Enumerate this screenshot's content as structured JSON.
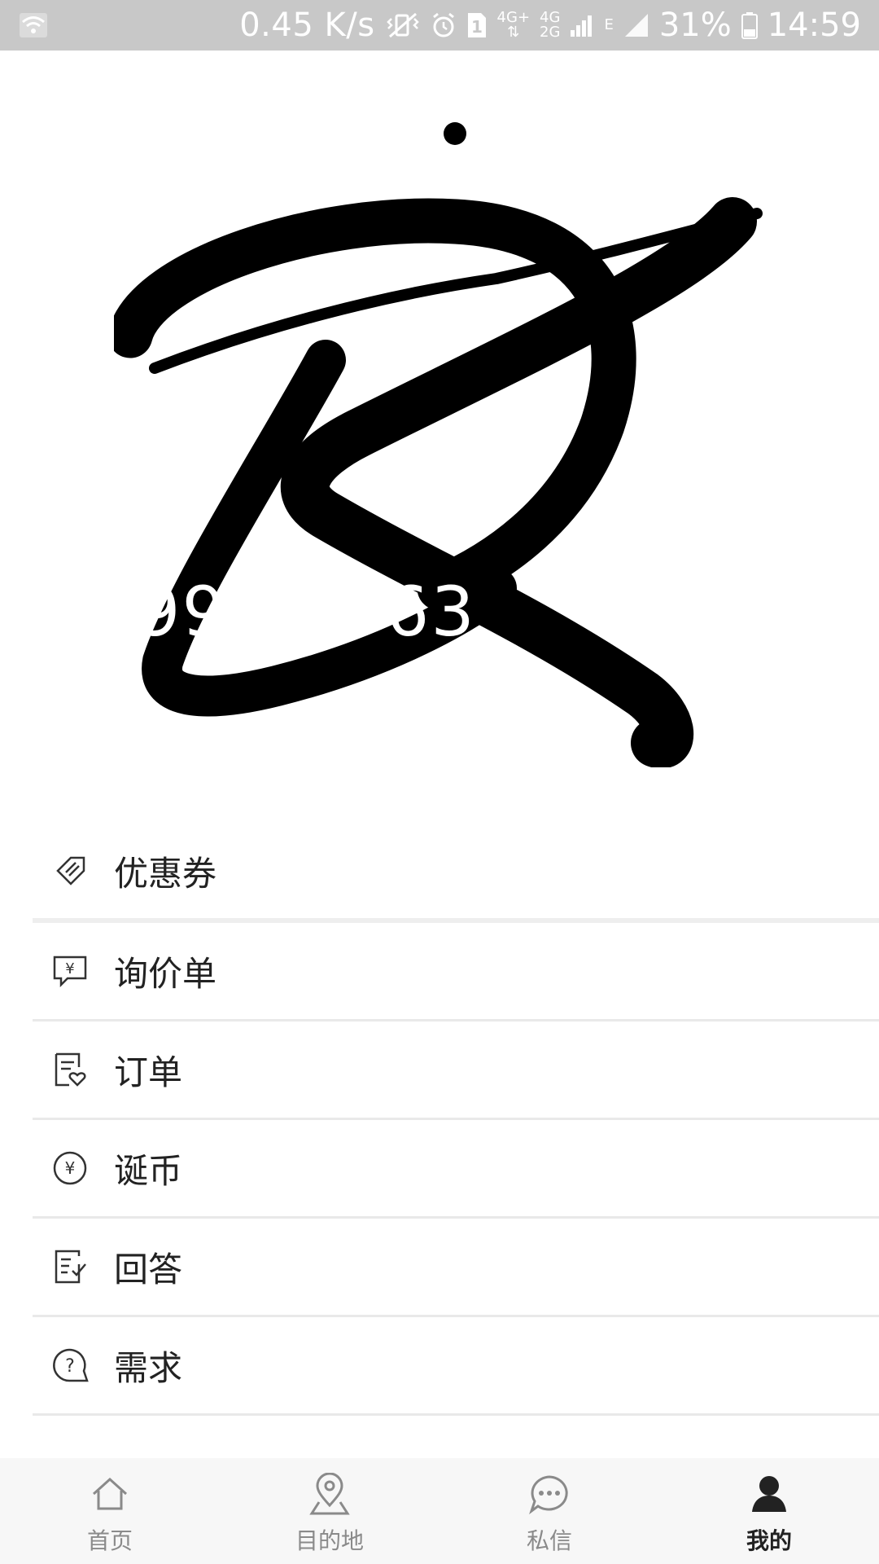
{
  "status_bar": {
    "speed": "0.45 K/s",
    "network_top": "4G+",
    "network_4g": "4G",
    "network_2g": "2G",
    "network_e": "E",
    "sim": "1",
    "battery": "31%",
    "time": "14:59"
  },
  "header": {
    "account_number": "99  30963"
  },
  "menu": {
    "items": [
      {
        "label": "优惠券",
        "icon": "coupon-icon"
      },
      {
        "label": "询价单",
        "icon": "quote-icon"
      },
      {
        "label": "订单",
        "icon": "order-icon"
      },
      {
        "label": "诞币",
        "icon": "coin-icon"
      },
      {
        "label": "回答",
        "icon": "answer-icon"
      },
      {
        "label": "需求",
        "icon": "question-icon"
      }
    ]
  },
  "bottom_nav": {
    "items": [
      {
        "label": "首页",
        "icon": "home-icon",
        "active": false
      },
      {
        "label": "目的地",
        "icon": "location-pin-icon",
        "active": false
      },
      {
        "label": "私信",
        "icon": "chat-bubble-icon",
        "active": false
      },
      {
        "label": "我的",
        "icon": "user-icon",
        "active": true
      }
    ]
  },
  "colors": {
    "status_bar_bg": "#c8c8c8",
    "nav_bg": "#f7f7f7",
    "divider": "#e9e9e9",
    "text_primary": "#222222",
    "text_muted": "#8a8a8a"
  }
}
